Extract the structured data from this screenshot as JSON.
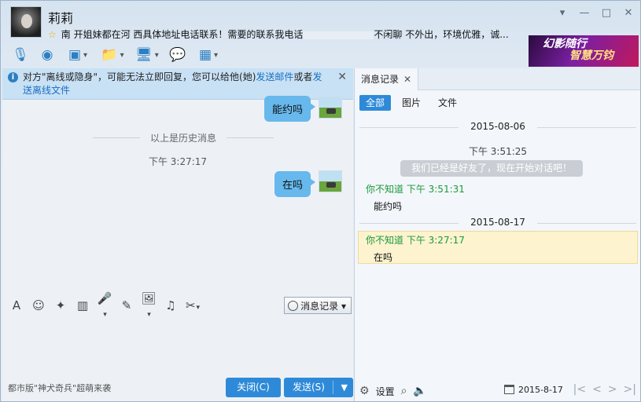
{
  "contact": {
    "name": "莉莉",
    "signature_prefix": "南 开姐妹都在河 西具体地址电话联系！需要的联系我电话",
    "signature_suffix": "不闲聊 不外出，环境优雅，诚..."
  },
  "window_controls": [
    "▾",
    "—",
    "□",
    "✕"
  ],
  "ad": {
    "line1": "幻影随行",
    "line2": "智慧万钧"
  },
  "toolbar": [
    {
      "name": "voice-call-icon",
      "glyph": "🎙",
      "drop": false
    },
    {
      "name": "video-call-icon",
      "glyph": "◉",
      "drop": false
    },
    {
      "name": "remote-desktop-icon",
      "glyph": "▣",
      "drop": true
    },
    {
      "name": "send-file-icon",
      "glyph": "📁",
      "drop": true
    },
    {
      "name": "screen-share-icon",
      "glyph": "🖥",
      "drop": true
    },
    {
      "name": "create-group-icon",
      "glyph": "💬",
      "drop": false
    },
    {
      "name": "apps-icon",
      "glyph": "▦",
      "drop": true
    }
  ],
  "notice": {
    "text_a": "对方\"离线或隐身\"，可能无法立即回复，您可以给他(她)",
    "link_email": "发送邮件",
    "text_b": "或者",
    "link_offline_file": "发送离线文件",
    "close": "✕"
  },
  "chat": {
    "history_divider": "以上是历史消息",
    "messages": [
      {
        "text": "能约吗"
      },
      {
        "time": "下午 3:27:17",
        "text": "在吗"
      }
    ]
  },
  "input_toolbar": [
    {
      "name": "font-icon",
      "glyph": "A",
      "drop": false
    },
    {
      "name": "emoji-icon",
      "glyph": "☺",
      "drop": false
    },
    {
      "name": "shake-icon",
      "glyph": "✦",
      "drop": false
    },
    {
      "name": "magic-expression-icon",
      "glyph": "▥",
      "drop": false
    },
    {
      "name": "voice-message-icon",
      "glyph": "🎤",
      "drop": true
    },
    {
      "name": "doodle-icon",
      "glyph": "✎",
      "drop": false
    },
    {
      "name": "image-icon",
      "glyph": "🖼",
      "drop": true
    },
    {
      "name": "music-icon",
      "glyph": "♫",
      "drop": false
    },
    {
      "name": "screenshot-icon",
      "glyph": "✂",
      "drop": true
    }
  ],
  "history_button": "消息记录",
  "ticker": "都市版\"神犬奇兵\"超萌来袭",
  "buttons": {
    "close": "关闭(C)",
    "send": "发送(S)",
    "send_arrow": "▼"
  },
  "history_panel": {
    "tab_title": "消息记录",
    "tab_close": "✕",
    "filters": [
      "全部",
      "图片",
      "文件"
    ],
    "entries": [
      {
        "date": "2015-08-06"
      },
      {
        "time": "下午 3:51:25",
        "system": "我们已经是好友了，现在开始对话吧！"
      },
      {
        "sender": "你不知道 下午 3:51:31",
        "text": "能约吗"
      },
      {
        "date": "2015-08-17"
      },
      {
        "sender": "你不知道 下午 3:27:17",
        "text": "在吗"
      }
    ],
    "footer": {
      "settings": "设置",
      "current_date": "2015-8-17"
    }
  }
}
